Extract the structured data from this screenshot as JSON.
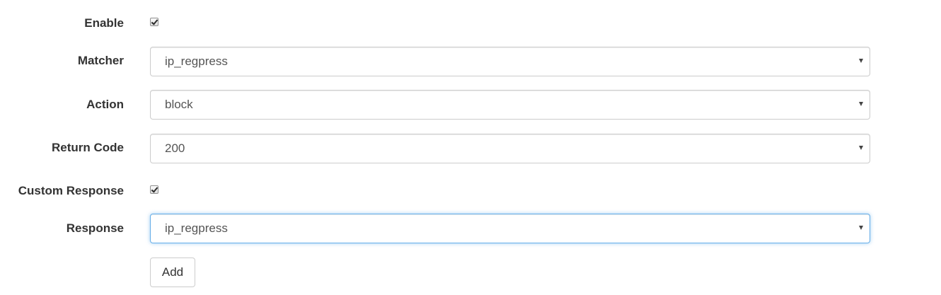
{
  "form": {
    "enable": {
      "label": "Enable",
      "checked": true
    },
    "matcher": {
      "label": "Matcher",
      "value": "ip_regpress"
    },
    "action": {
      "label": "Action",
      "value": "block"
    },
    "return_code": {
      "label": "Return Code",
      "value": "200"
    },
    "custom_response": {
      "label": "Custom Response",
      "checked": true
    },
    "response": {
      "label": "Response",
      "value": "ip_regpress"
    },
    "add_button": {
      "label": "Add"
    }
  },
  "colors": {
    "focus_border": "#66afe9",
    "border": "#cccccc",
    "label_text": "#333333",
    "value_text": "#555555"
  },
  "icons": {
    "checkbox_mark": "checkmark-icon",
    "select_caret": "caret-down-icon"
  }
}
